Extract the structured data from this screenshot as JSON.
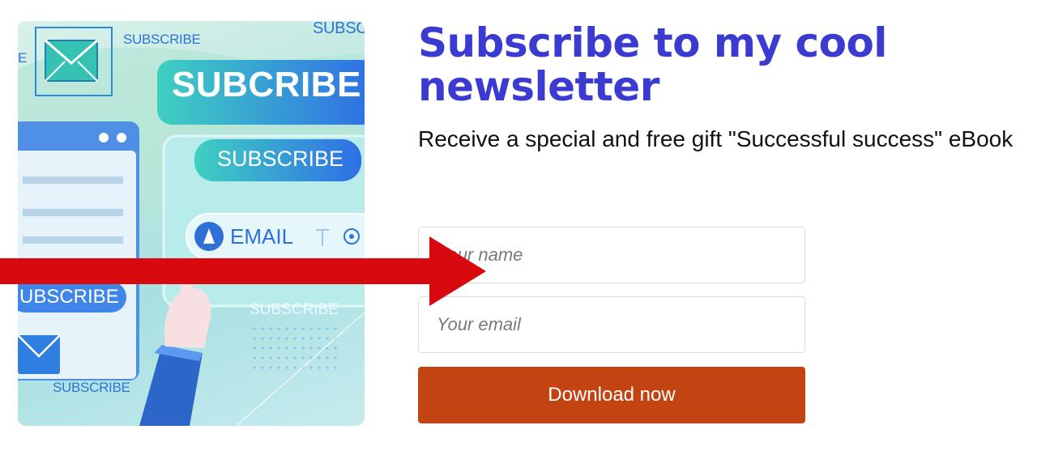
{
  "hero": {
    "labels": {
      "top_small": "SUBSCRIBE",
      "top_right_small": "SUBSC",
      "big": "SUBCRIBE",
      "mid_button": "SUBSCRIBE",
      "email_field": "EMAIL",
      "left_pill": "UBSCRIBE",
      "faint": "SUBSCRIBE",
      "bottom_small": "SUBSCRIBE",
      "left_edge_letter": "E"
    },
    "icons": [
      "envelope-icon",
      "envelope-icon",
      "pointing-hand-icon",
      "cursor-icon"
    ]
  },
  "headline": "Subscribe to my cool newsletter",
  "subtitle": "Receive a special and free gift \"Successful success\" eBook",
  "form": {
    "name_placeholder": "Your name",
    "email_placeholder": "Your email",
    "submit_label": "Download now"
  },
  "colors": {
    "headline": "#3b3bd1",
    "button": "#c34412",
    "arrow": "#d80a10"
  }
}
